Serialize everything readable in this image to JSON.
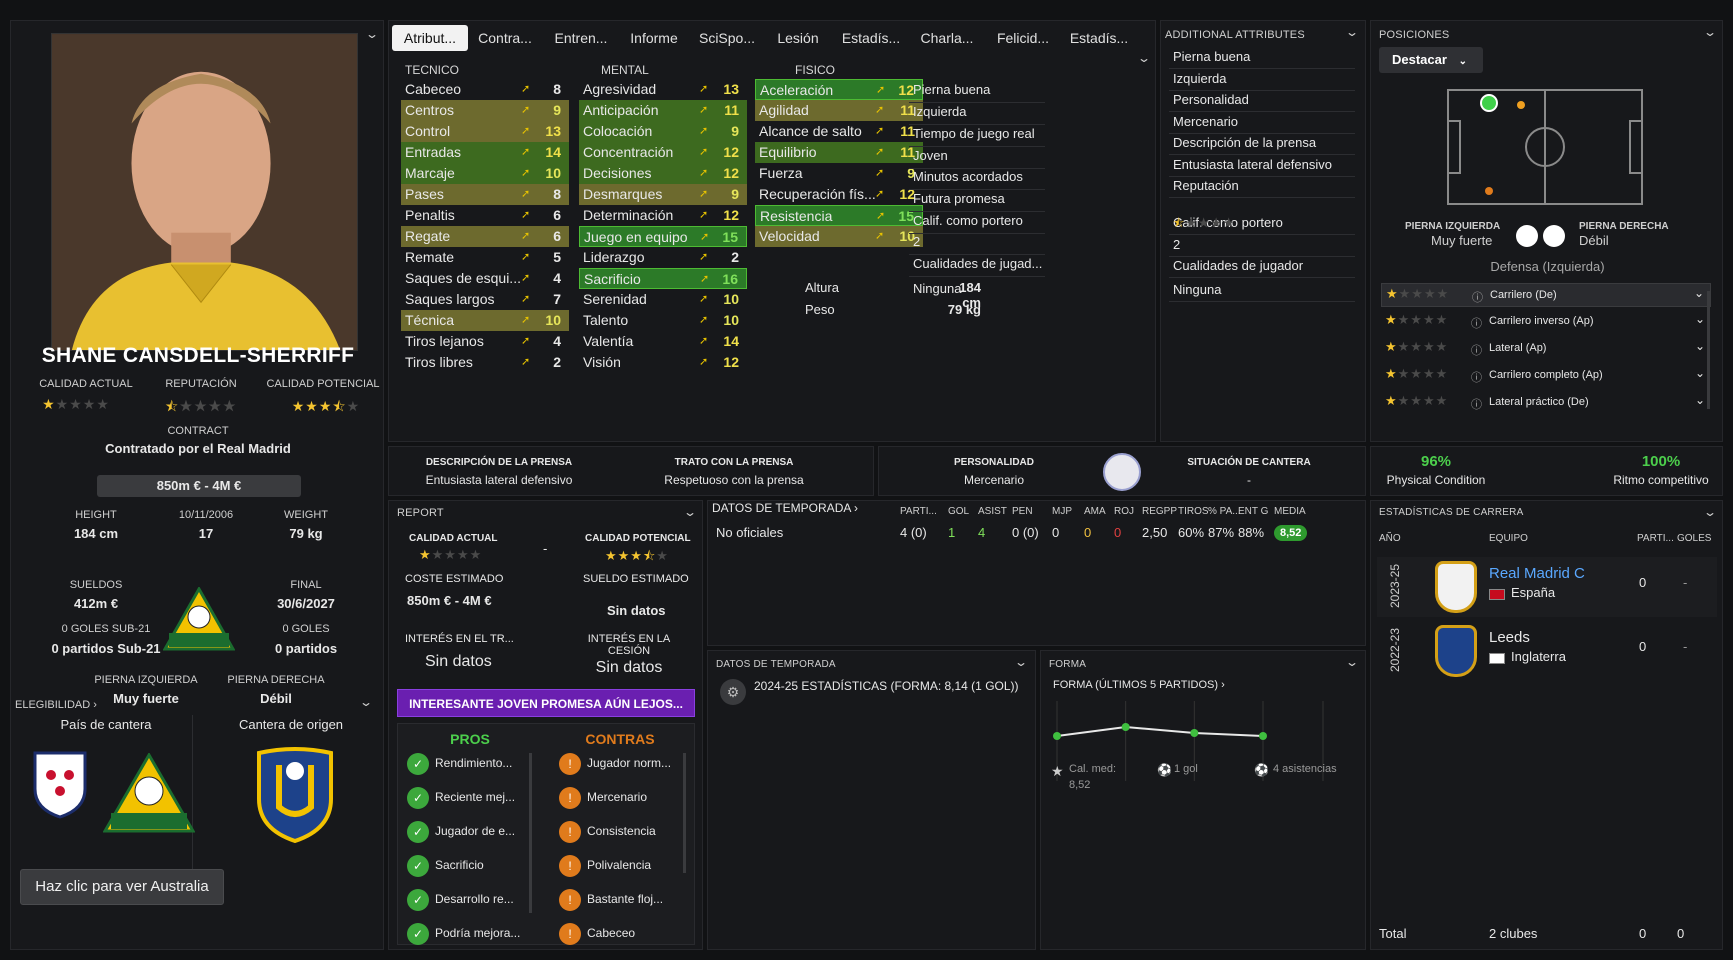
{
  "player": {
    "name": "SHANE CANSDELL-SHERRIFF",
    "current_ability_label": "CALIDAD ACTUAL",
    "reputation_label": "REPUTACIÓN",
    "potential_label": "CALIDAD POTENCIAL",
    "current_ability_stars": 1,
    "reputation_stars": 0.5,
    "potential_stars": 3.5,
    "contract_label": "CONTRACT",
    "contract_value": "Contratado por el Real Madrid",
    "value": "850m € - 4M €",
    "height_label": "HEIGHT",
    "height": "184 cm",
    "dob_label": "10/11/2006",
    "age": "17",
    "weight_label": "WEIGHT",
    "weight": "79 kg",
    "wages_label": "SUELDOS",
    "wages": "412m €",
    "end_label": "FINAL",
    "end": "30/6/2027",
    "u21_goals": "0 GOLES SUB-21",
    "u21_apps": "0 partidos Sub-21",
    "goals": "0 GOLES",
    "apps": "0 partidos",
    "left_foot_label": "PIERNA IZQUIERDA",
    "left_foot": "Muy fuerte",
    "right_foot_label": "PIERNA DERECHA",
    "right_foot": "Débil",
    "eligibility_label": "ELEGIBILIDAD",
    "youth_country_label": "País de cantera",
    "youth_club_label": "Cantera de origen",
    "view_button": "Haz clic para ver Australia",
    "soccer_badge_text": "SOCCER",
    "soccer_badge_top": "AUSTRALIAN"
  },
  "tabs": [
    "Atribut...",
    "Contra...",
    "Entren...",
    "Informe",
    "SciSpo...",
    "Lesión",
    "Estadís...",
    "Charla...",
    "Felicid...",
    "Estadís..."
  ],
  "technical": {
    "title": "TECNICO",
    "rows": [
      {
        "name": "Cabeceo",
        "value": "8",
        "hl": ""
      },
      {
        "name": "Centros",
        "value": "9",
        "hl": "y"
      },
      {
        "name": "Control",
        "value": "13",
        "hl": "y"
      },
      {
        "name": "Entradas",
        "value": "14",
        "hl": "g"
      },
      {
        "name": "Marcaje",
        "value": "10",
        "hl": "g"
      },
      {
        "name": "Pases",
        "value": "8",
        "hl": "y"
      },
      {
        "name": "Penaltis",
        "value": "6",
        "hl": ""
      },
      {
        "name": "Regate",
        "value": "6",
        "hl": "y"
      },
      {
        "name": "Remate",
        "value": "5",
        "hl": ""
      },
      {
        "name": "Saques de esqui...",
        "value": "4",
        "hl": ""
      },
      {
        "name": "Saques largos",
        "value": "7",
        "hl": ""
      },
      {
        "name": "Técnica",
        "value": "10",
        "hl": "y"
      },
      {
        "name": "Tiros lejanos",
        "value": "4",
        "hl": ""
      },
      {
        "name": "Tiros libres",
        "value": "2",
        "hl": ""
      }
    ]
  },
  "mental": {
    "title": "MENTAL",
    "rows": [
      {
        "name": "Agresividad",
        "value": "13",
        "hl": ""
      },
      {
        "name": "Anticipación",
        "value": "11",
        "hl": "g"
      },
      {
        "name": "Colocación",
        "value": "9",
        "hl": "g"
      },
      {
        "name": "Concentración",
        "value": "12",
        "hl": "g"
      },
      {
        "name": "Decisiones",
        "value": "12",
        "hl": "g"
      },
      {
        "name": "Desmarques",
        "value": "9",
        "hl": "y"
      },
      {
        "name": "Determinación",
        "value": "12",
        "hl": ""
      },
      {
        "name": "Juego en equipo",
        "value": "15",
        "hl": "gb"
      },
      {
        "name": "Liderazgo",
        "value": "2",
        "hl": ""
      },
      {
        "name": "Sacrificio",
        "value": "16",
        "hl": "gb"
      },
      {
        "name": "Serenidad",
        "value": "10",
        "hl": ""
      },
      {
        "name": "Talento",
        "value": "10",
        "hl": ""
      },
      {
        "name": "Valentía",
        "value": "14",
        "hl": ""
      },
      {
        "name": "Visión",
        "value": "12",
        "hl": ""
      }
    ]
  },
  "physical": {
    "title": "FISICO",
    "rows": [
      {
        "name": "Aceleración",
        "value": "12",
        "hl": "gb"
      },
      {
        "name": "Agilidad",
        "value": "11",
        "hl": "y"
      },
      {
        "name": "Alcance de salto",
        "value": "11",
        "hl": ""
      },
      {
        "name": "Equilibrio",
        "value": "11",
        "hl": "g"
      },
      {
        "name": "Fuerza",
        "value": "9",
        "hl": ""
      },
      {
        "name": "Recuperación fís...",
        "value": "12",
        "hl": ""
      },
      {
        "name": "Resistencia",
        "value": "15",
        "hl": "gb"
      },
      {
        "name": "Velocidad",
        "value": "10",
        "hl": "y"
      }
    ],
    "height_label": "Altura",
    "height": "184 cm",
    "weight_label": "Peso",
    "weight": "79 kg"
  },
  "misc_col": [
    "Pierna buena",
    "Izquierda",
    "Tiempo de juego real",
    "Joven",
    "Minutos acordados",
    "Futura promesa",
    "Calif. como portero",
    "2",
    "Cualidades de jugad...",
    "Ninguna"
  ],
  "additional": {
    "title": "ADDITIONAL ATTRIBUTES",
    "items": [
      "Pierna buena",
      "Izquierda",
      "Personalidad",
      "Mercenario",
      "Descripción de la prensa",
      "Entusiasta lateral defensivo",
      "Reputación",
      "",
      "Calif. como portero",
      "2",
      "Cualidades de jugador",
      "Ninguna"
    ]
  },
  "positions": {
    "title": "POSICIONES",
    "dropdown": "Destacar",
    "left_foot_label": "PIERNA IZQUIERDA",
    "left_foot": "Muy fuerte",
    "right_foot_label": "PIERNA DERECHA",
    "right_foot": "Débil",
    "role_title": "Defensa (Izquierda)",
    "roles": [
      {
        "name": "Carrilero (De)",
        "stars": 1
      },
      {
        "name": "Carrilero inverso (Ap)",
        "stars": 1
      },
      {
        "name": "Lateral (Ap)",
        "stars": 1
      },
      {
        "name": "Carrilero completo (Ap)",
        "stars": 1
      },
      {
        "name": "Lateral práctico (De)",
        "stars": 1
      }
    ]
  },
  "press": {
    "desc_label": "DESCRIPCIÓN DE LA PRENSA",
    "desc": "Entusiasta lateral defensivo",
    "treat_label": "TRATO CON LA PRENSA",
    "treat": "Respetuoso con la prensa"
  },
  "personality": {
    "label": "PERSONALIDAD",
    "value": "Mercenario",
    "youth_label": "SITUACIÓN DE CANTERA",
    "youth": "-"
  },
  "condition": {
    "physical_pct": "96%",
    "physical_label": "Physical Condition",
    "match_pct": "100%",
    "match_label": "Ritmo competitivo"
  },
  "report": {
    "title": "REPORT",
    "ca_label": "CALIDAD ACTUAL",
    "pa_label": "CALIDAD POTENCIAL",
    "ca_stars": 1,
    "pa_stars": 3.5,
    "dash": "-",
    "cost_label": "COSTE ESTIMADO",
    "cost": "850m € - 4M €",
    "wage_label": "SUELDO ESTIMADO",
    "wage": "Sin datos",
    "transfer_label": "INTERÉS EN EL TR...",
    "transfer": "Sin datos",
    "loan_label": "INTERÉS EN LA CESIÓN",
    "loan": "Sin datos",
    "banner": "INTERESANTE JOVEN PROMESA AÚN LEJOS...",
    "pros_label": "PROS",
    "cons_label": "CONTRAS",
    "pros": [
      "Rendimiento...",
      "Reciente mej...",
      "Jugador de e...",
      "Sacrificio",
      "Desarrollo re...",
      "Podría mejora..."
    ],
    "cons": [
      "Jugador norm...",
      "Mercenario",
      "Consistencia",
      "Polivalencia",
      "Bastante floj...",
      "Cabeceo"
    ]
  },
  "season": {
    "title": "DATOS DE TEMPORADA",
    "headers": [
      "PARTI...",
      "GOL",
      "ASIST",
      "PEN",
      "MJP",
      "AMA",
      "ROJ",
      "REGPP",
      "TIROS",
      "% PA...",
      "ENT G",
      "MEDIA"
    ],
    "row_label": "No oficiales",
    "row": [
      "4 (0)",
      "1",
      "4",
      "0 (0)",
      "0",
      "0",
      "0",
      "2,50",
      "60%",
      "87%",
      "88%",
      "8,52"
    ]
  },
  "season2": {
    "title": "DATOS DE TEMPORADA",
    "line": "2024-25 ESTADÍSTICAS (FORMA: 8,14 (1 GOL))"
  },
  "form": {
    "title": "FORMA",
    "subtitle": "FORMA (ÚLTIMOS 5 PARTIDOS)",
    "avg_label": "Cal. med:",
    "avg": "8,52",
    "goals": "1 gol",
    "assists": "4 asistencias",
    "points": [
      6.9,
      7.2,
      7.0,
      6.9
    ]
  },
  "career": {
    "title": "ESTADÍSTICAS DE CARRERA",
    "h_year": "AÑO",
    "h_team": "EQUIPO",
    "h_apps": "PARTI...",
    "h_goals": "GOLES",
    "rows": [
      {
        "year": "2023-25",
        "team": "Real Madrid C",
        "country": "España",
        "apps": "0",
        "goals": "-"
      },
      {
        "year": "2022-23",
        "team": "Leeds",
        "country": "Inglaterra",
        "apps": "0",
        "goals": "-"
      }
    ],
    "total_label": "Total",
    "total_clubs": "2 clubes",
    "total_apps": "0",
    "total_goals": "0"
  },
  "colors": {
    "green": "#3d6a1f",
    "yellow": "#6d6a2e",
    "accent": "#4dbb33",
    "purple": "#6a1fb0"
  }
}
